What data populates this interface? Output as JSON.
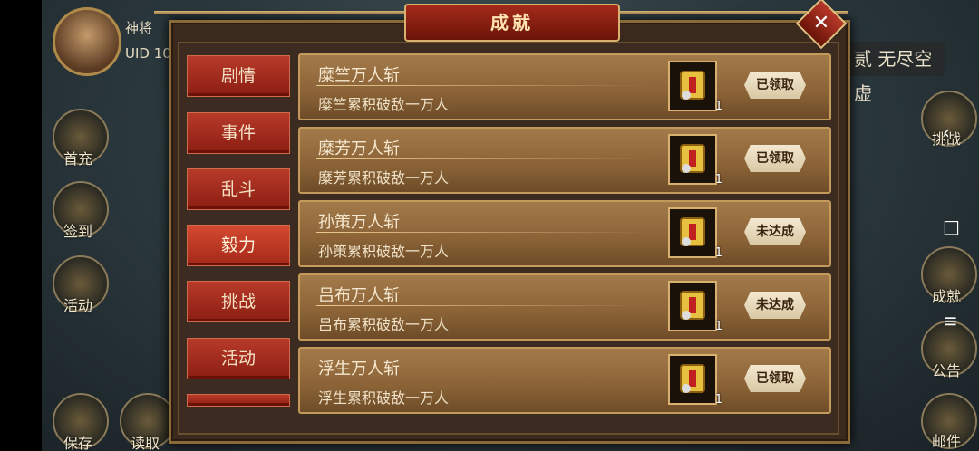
{
  "hud": {
    "name": "神将",
    "uid": "UID  10",
    "stage_label": "贰 无尽空虚",
    "left_buttons": [
      "首充",
      "签到",
      "活动",
      "保存",
      "读取"
    ],
    "right_buttons": [
      "挑战",
      "成就",
      "公告",
      "邮件"
    ]
  },
  "dialog": {
    "title": "成就",
    "close_label": "✕"
  },
  "tabs": [
    "剧情",
    "事件",
    "乱斗",
    "毅力",
    "挑战",
    "活动"
  ],
  "active_tab": "毅力",
  "achievements": [
    {
      "title": "糜竺万人斩",
      "desc": "糜竺累积破敌一万人",
      "reward_count": "1",
      "status": "已领取"
    },
    {
      "title": "糜芳万人斩",
      "desc": "糜芳累积破敌一万人",
      "reward_count": "1",
      "status": "已领取"
    },
    {
      "title": "孙策万人斩",
      "desc": "孙策累积破敌一万人",
      "reward_count": "1",
      "status": "未达成"
    },
    {
      "title": "吕布万人斩",
      "desc": "吕布累积破敌一万人",
      "reward_count": "1",
      "status": "未达成"
    },
    {
      "title": "浮生万人斩",
      "desc": "浮生累积破敌一万人",
      "reward_count": "1",
      "status": "已领取"
    }
  ],
  "system_nav": {
    "back": "‹",
    "home": "□",
    "menu": "≡"
  },
  "colors": {
    "accent_red": "#a42a1a",
    "gold": "#d8b070",
    "panel": "#3a2a1e"
  }
}
